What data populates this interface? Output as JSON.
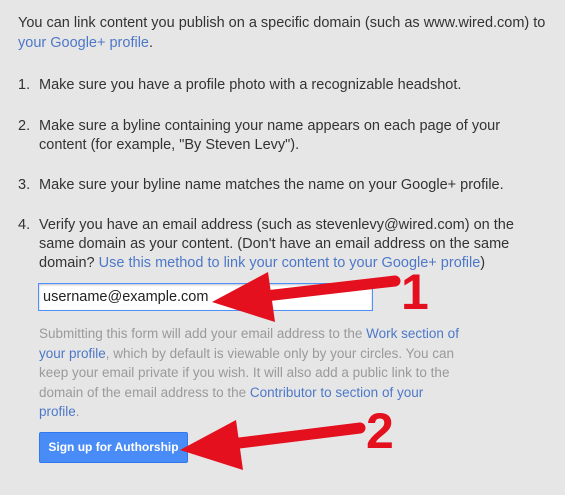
{
  "intro": {
    "text": "You can link content you publish on a specific domain (such as www.wired.com) to ",
    "link": "your Google+ profile",
    "end": "."
  },
  "steps": [
    {
      "num": "1.",
      "text": "Make sure you have a profile photo with a recognizable headshot."
    },
    {
      "num": "2.",
      "text": "Make sure a byline containing your name appears on each page of your content (for example, \"By Steven Levy\")."
    },
    {
      "num": "3.",
      "text": "Make sure your byline name matches the name on your Google+ profile."
    },
    {
      "num": "4.",
      "text": "Verify you have an email address (such as stevenlevy@wired.com) on the same domain as your content. (Don't have an email address on the same domain? ",
      "link": "Use this method to link your content to your Google+ profile",
      "end": ")"
    }
  ],
  "form": {
    "email_value": "username@example.com",
    "note_part1": "Submitting this form will add your email address to the ",
    "note_link1": "Work section of your profile",
    "note_part2": ", which by default is viewable only by your circles. You can keep your email private if you wish. It will also add a public link to the domain of the email address to the ",
    "note_link2": "Contributor to section of your profile",
    "note_end": ".",
    "button_label": "Sign up for Authorship"
  },
  "annotations": {
    "arrow1_label": "1",
    "arrow2_label": "2",
    "arrow_color": "#e4101d"
  }
}
